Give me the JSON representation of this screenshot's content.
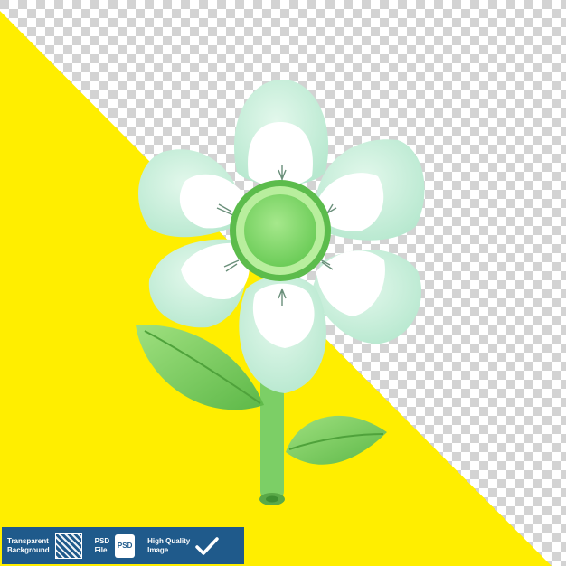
{
  "background": {
    "checker_light": "#ffffff",
    "checker_dark": "#d3d3d3",
    "accent_yellow": "#ffee00"
  },
  "flower": {
    "petal_outer": "#c9f0dc",
    "petal_inner": "#ffffff",
    "center": "#8edb74",
    "center_ring": "#5cbc4c",
    "stem": "#7ccf66",
    "leaf": "#71c659"
  },
  "badge": {
    "background": "#1f5a8b",
    "items": [
      {
        "label": "Transparent\nBackground",
        "icon": "grid-icon"
      },
      {
        "label": "PSD\nFile",
        "icon": "psd-icon",
        "icon_text": "PSD"
      },
      {
        "label": "High Quality\nImage",
        "icon": "check-icon"
      }
    ]
  }
}
